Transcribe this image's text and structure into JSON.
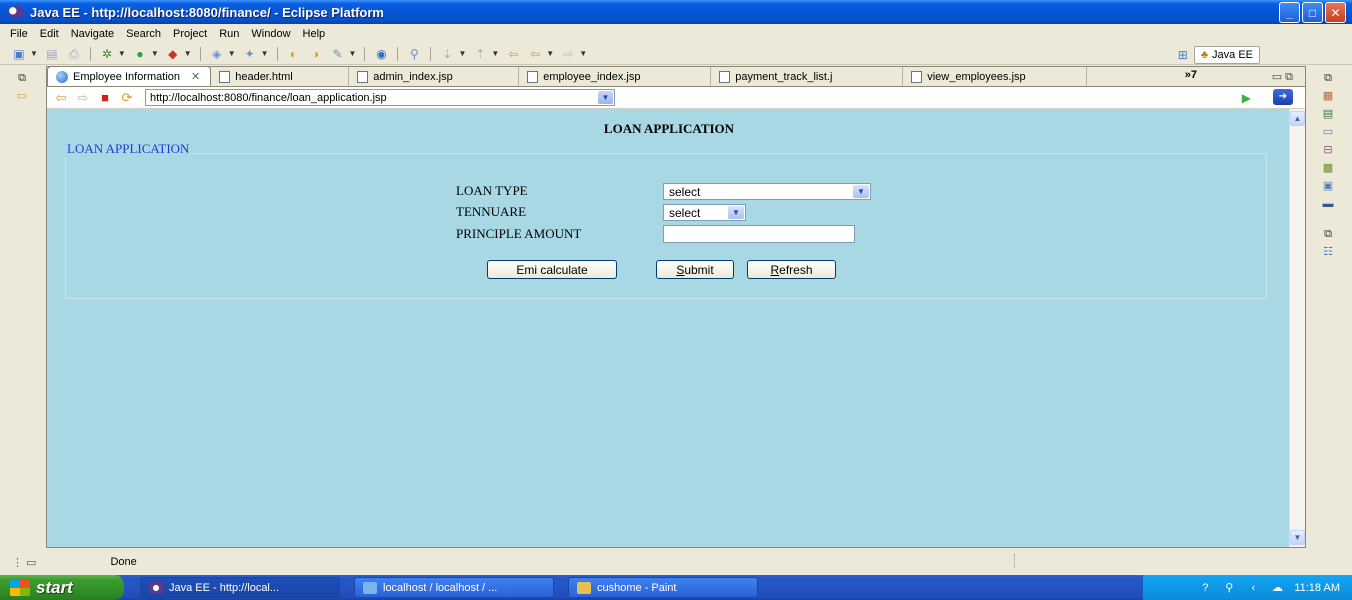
{
  "window": {
    "title": "Java EE - http://localhost:8080/finance/ - Eclipse Platform"
  },
  "menu": [
    "File",
    "Edit",
    "Navigate",
    "Search",
    "Project",
    "Run",
    "Window",
    "Help"
  ],
  "perspective": {
    "label": "Java EE"
  },
  "tabs": [
    {
      "label": "Employee Information",
      "icon": "globe-icon",
      "active": true
    },
    {
      "label": "header.html",
      "icon": "file-icon"
    },
    {
      "label": "admin_index.jsp",
      "icon": "file-icon"
    },
    {
      "label": "employee_index.jsp",
      "icon": "file-icon"
    },
    {
      "label": "payment_track_list.j",
      "icon": "file-icon"
    },
    {
      "label": "view_employees.jsp",
      "icon": "file-icon"
    }
  ],
  "tab_overflow": "»7",
  "browser": {
    "url": "http://localhost:8080/finance/loan_application.jsp"
  },
  "page": {
    "heading": "LOAN APPLICATION",
    "legend": "LOAN APPLICATION",
    "loan_type_label": "LOAN TYPE",
    "loan_type_value": "select",
    "tenure_label": "TENNUARE",
    "tenure_value": "select",
    "amount_label": "PRINCIPLE AMOUNT",
    "amount_value": "",
    "emi_button": "Emi calculate",
    "submit_first": "S",
    "submit_rest": "ubmit",
    "refresh_first": "R",
    "refresh_rest": "efresh"
  },
  "status": {
    "text": "Done"
  },
  "taskbar": {
    "start": "start",
    "tasks": [
      "Java EE - http://local...",
      "localhost / localhost / ...",
      "cushome - Paint"
    ],
    "clock": "11:18 AM"
  },
  "colors": {
    "page_bg": "#a8d8e4",
    "legend": "#1a3ed6",
    "titlebar": "#0556d6"
  }
}
